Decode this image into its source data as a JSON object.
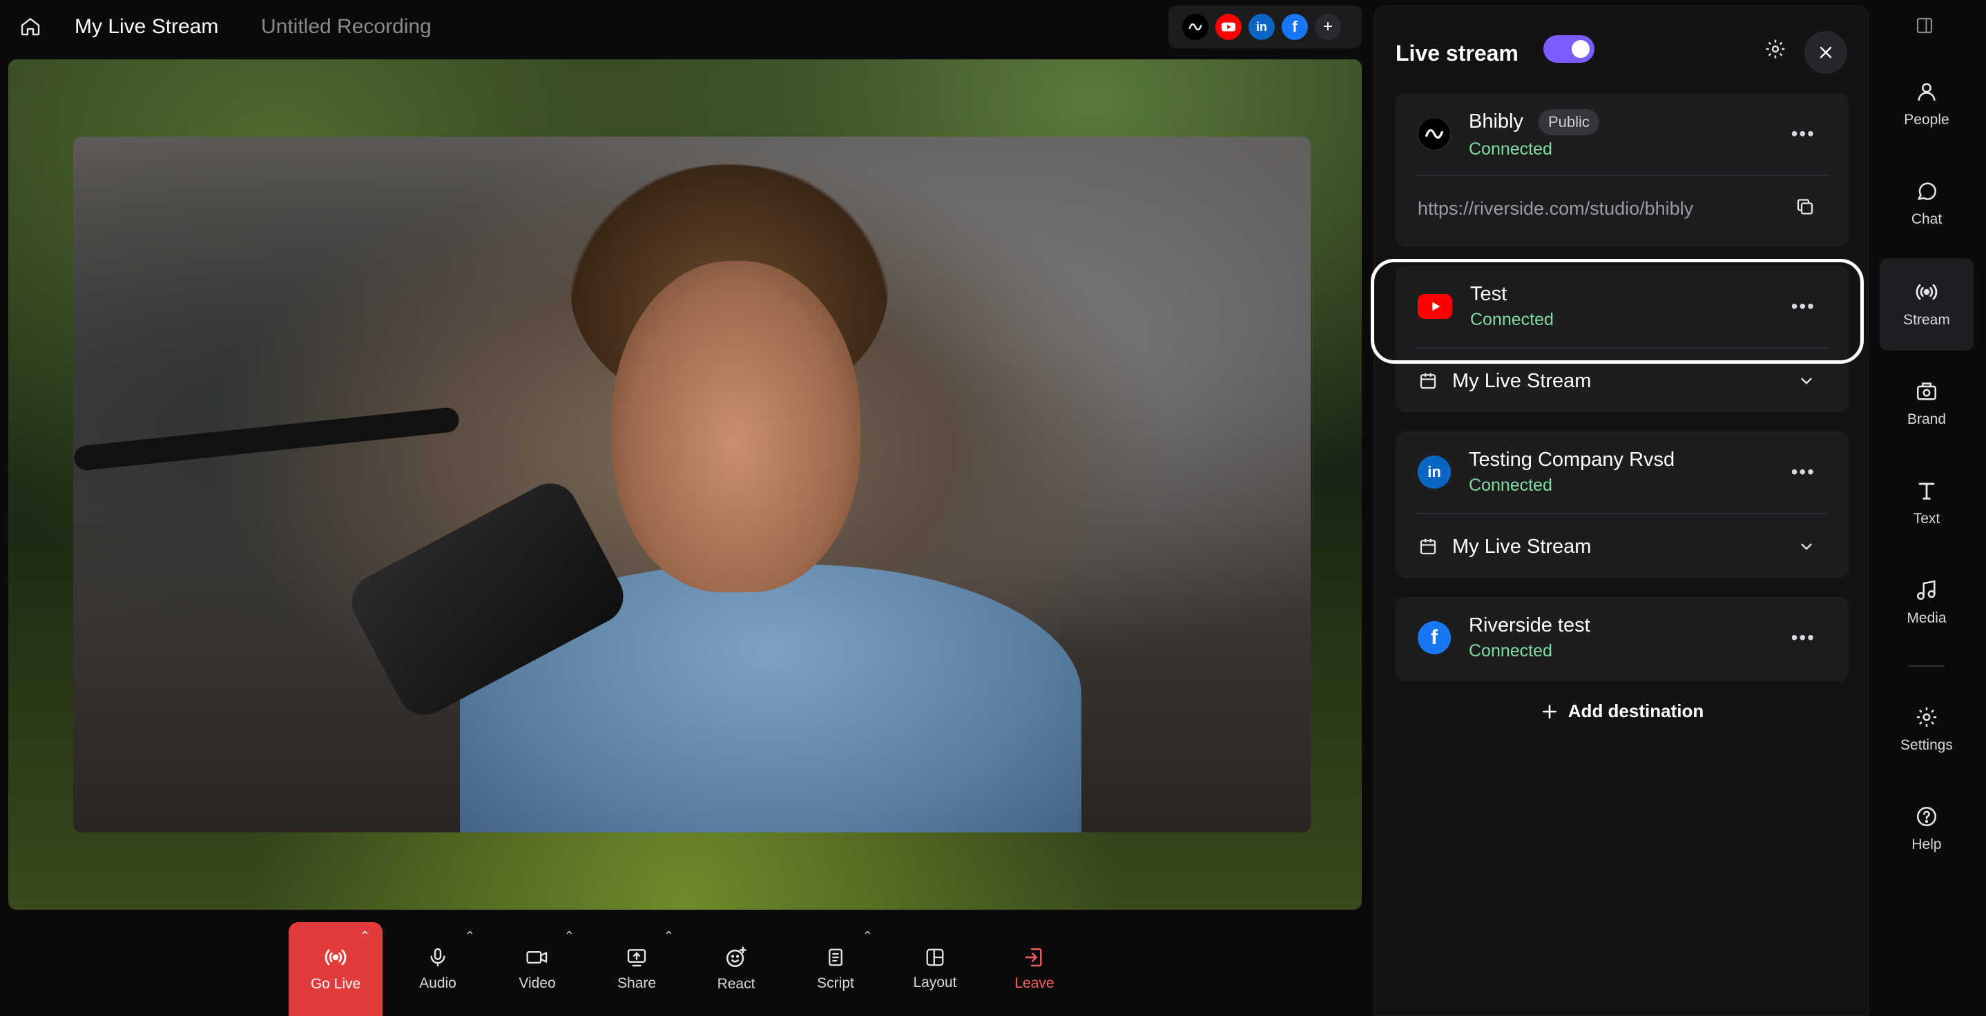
{
  "header": {
    "stream_title": "My Live Stream",
    "recording_title": "Untitled Recording",
    "destination_icons": [
      "riverside-icon",
      "youtube-icon",
      "linkedin-icon",
      "facebook-icon",
      "plus-icon"
    ]
  },
  "controls": {
    "go_live": "Go Live",
    "audio": "Audio",
    "video": "Video",
    "share": "Share",
    "react": "React",
    "script": "Script",
    "layout": "Layout",
    "leave": "Leave"
  },
  "panel": {
    "title": "Live stream",
    "toggle_on": true,
    "destinations": [
      {
        "name": "Bhibly",
        "badge": "Public",
        "status": "Connected",
        "url": "https://riverside.com/studio/bhibly"
      },
      {
        "name": "Test",
        "status": "Connected",
        "schedule": "My Live Stream"
      },
      {
        "name": "Testing Company Rvsd",
        "status": "Connected",
        "schedule": "My Live Stream"
      },
      {
        "name": "Riverside test",
        "status": "Connected"
      }
    ],
    "add_destination": "Add destination"
  },
  "sidebar": {
    "items": [
      {
        "label": "People"
      },
      {
        "label": "Chat"
      },
      {
        "label": "Stream",
        "active": true
      },
      {
        "label": "Brand"
      },
      {
        "label": "Text"
      },
      {
        "label": "Media"
      },
      {
        "label": "Settings"
      },
      {
        "label": "Help"
      }
    ]
  },
  "colors": {
    "accent": "#7b5cff",
    "go_live": "#e23b3b",
    "connected": "#7fdca0",
    "youtube": "#ff0000",
    "linkedin": "#0a66c2",
    "facebook": "#1877f2",
    "leave": "#ff5c5c"
  }
}
